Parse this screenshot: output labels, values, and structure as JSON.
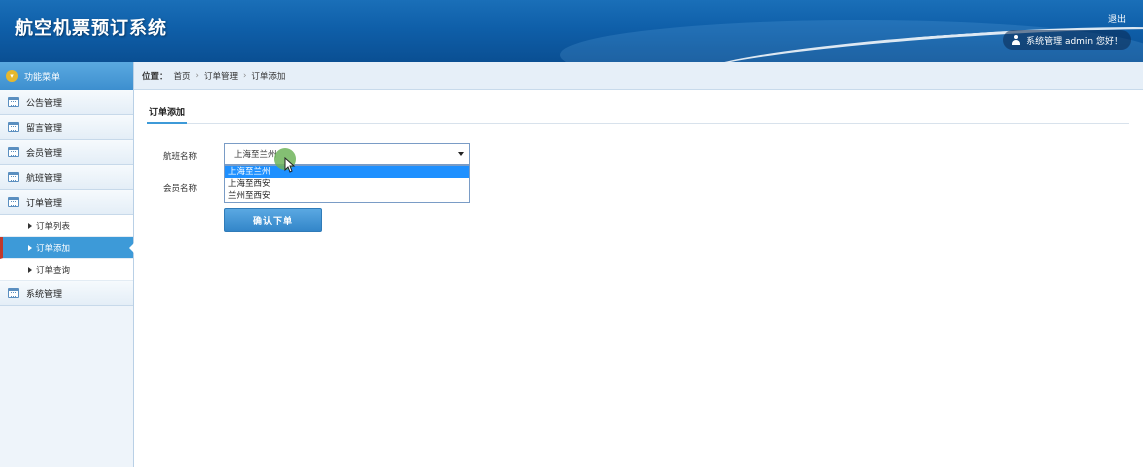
{
  "app": {
    "title": "航空机票预订系统",
    "logout_label": "退出",
    "user_greeting": "系统管理 admin 您好！"
  },
  "sidebar": {
    "header_label": "功能菜单",
    "groups": [
      {
        "label": "公告管理"
      },
      {
        "label": "留言管理"
      },
      {
        "label": "会员管理"
      },
      {
        "label": "航班管理"
      },
      {
        "label": "订单管理"
      }
    ],
    "sub_items": [
      {
        "label": "订单列表"
      },
      {
        "label": "订单添加"
      },
      {
        "label": "订单查询"
      }
    ],
    "last_group": {
      "label": "系统管理"
    }
  },
  "breadcrumb": {
    "prefix": "位置：",
    "items": [
      "首页",
      "订单管理",
      "订单添加"
    ],
    "separator": "›"
  },
  "form": {
    "tab_label": "订单添加",
    "flight_label": "航班名称",
    "member_label": "会员名称",
    "flight_selected": "上海至兰州",
    "flight_options": [
      "上海至兰州",
      "上海至西安",
      "兰州至西安"
    ],
    "submit_label": "确认下单"
  },
  "colors": {
    "header_blue": "#0f5fa9",
    "active_blue": "#3d9ad8",
    "option_highlight": "#1e90ff"
  }
}
